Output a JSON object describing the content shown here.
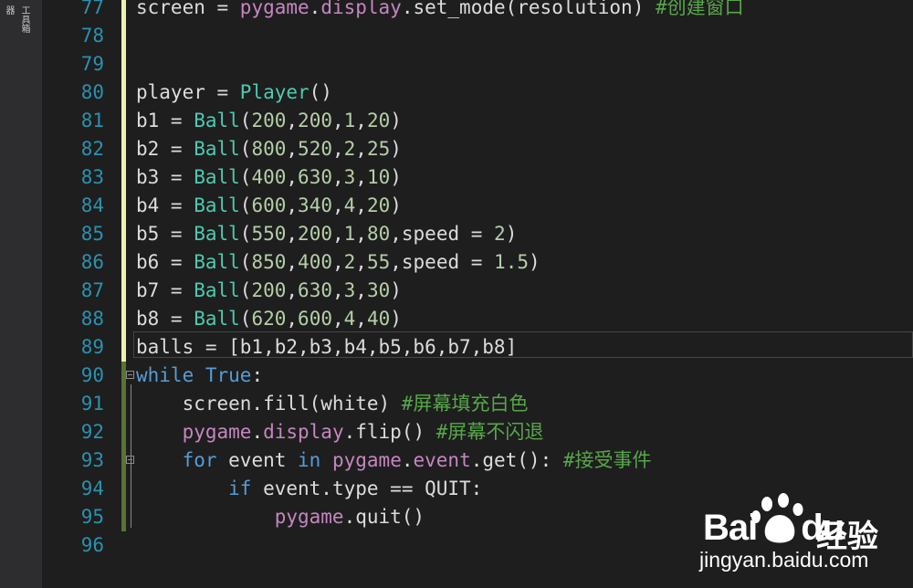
{
  "side_panel": {
    "tabs": [
      "器",
      "工具箱"
    ]
  },
  "watermark": {
    "brand": "Bai",
    "brand_suffix": "du",
    "cn": "经验",
    "url": "jingyan.baidu.com"
  },
  "editor": {
    "lines": [
      {
        "n": "77",
        "tokens": [
          [
            "plain",
            "screen = "
          ],
          [
            "mod",
            "pygame"
          ],
          [
            "plain",
            "."
          ],
          [
            "mod",
            "display"
          ],
          [
            "plain",
            "."
          ],
          [
            "plain",
            "set_mode(resolution) "
          ],
          [
            "cm",
            "#创建窗口"
          ]
        ]
      },
      {
        "n": "78",
        "tokens": []
      },
      {
        "n": "79",
        "tokens": []
      },
      {
        "n": "80",
        "tokens": [
          [
            "plain",
            "player = "
          ],
          [
            "cls",
            "Player"
          ],
          [
            "plain",
            "()"
          ]
        ]
      },
      {
        "n": "81",
        "tokens": [
          [
            "plain",
            "b1 = "
          ],
          [
            "cls",
            "Ball"
          ],
          [
            "plain",
            "("
          ],
          [
            "num",
            "200"
          ],
          [
            "plain",
            ","
          ],
          [
            "num",
            "200"
          ],
          [
            "plain",
            ","
          ],
          [
            "num",
            "1"
          ],
          [
            "plain",
            ","
          ],
          [
            "num",
            "20"
          ],
          [
            "plain",
            ")"
          ]
        ]
      },
      {
        "n": "82",
        "tokens": [
          [
            "plain",
            "b2 = "
          ],
          [
            "cls",
            "Ball"
          ],
          [
            "plain",
            "("
          ],
          [
            "num",
            "800"
          ],
          [
            "plain",
            ","
          ],
          [
            "num",
            "520"
          ],
          [
            "plain",
            ","
          ],
          [
            "num",
            "2"
          ],
          [
            "plain",
            ","
          ],
          [
            "num",
            "25"
          ],
          [
            "plain",
            ")"
          ]
        ]
      },
      {
        "n": "83",
        "tokens": [
          [
            "plain",
            "b3 = "
          ],
          [
            "cls",
            "Ball"
          ],
          [
            "plain",
            "("
          ],
          [
            "num",
            "400"
          ],
          [
            "plain",
            ","
          ],
          [
            "num",
            "630"
          ],
          [
            "plain",
            ","
          ],
          [
            "num",
            "3"
          ],
          [
            "plain",
            ","
          ],
          [
            "num",
            "10"
          ],
          [
            "plain",
            ")"
          ]
        ]
      },
      {
        "n": "84",
        "tokens": [
          [
            "plain",
            "b4 = "
          ],
          [
            "cls",
            "Ball"
          ],
          [
            "plain",
            "("
          ],
          [
            "num",
            "600"
          ],
          [
            "plain",
            ","
          ],
          [
            "num",
            "340"
          ],
          [
            "plain",
            ","
          ],
          [
            "num",
            "4"
          ],
          [
            "plain",
            ","
          ],
          [
            "num",
            "20"
          ],
          [
            "plain",
            ")"
          ]
        ]
      },
      {
        "n": "85",
        "tokens": [
          [
            "plain",
            "b5 = "
          ],
          [
            "cls",
            "Ball"
          ],
          [
            "plain",
            "("
          ],
          [
            "num",
            "550"
          ],
          [
            "plain",
            ","
          ],
          [
            "num",
            "200"
          ],
          [
            "plain",
            ","
          ],
          [
            "num",
            "1"
          ],
          [
            "plain",
            ","
          ],
          [
            "num",
            "80"
          ],
          [
            "plain",
            ",speed = "
          ],
          [
            "num",
            "2"
          ],
          [
            "plain",
            ")"
          ]
        ]
      },
      {
        "n": "86",
        "tokens": [
          [
            "plain",
            "b6 = "
          ],
          [
            "cls",
            "Ball"
          ],
          [
            "plain",
            "("
          ],
          [
            "num",
            "850"
          ],
          [
            "plain",
            ","
          ],
          [
            "num",
            "400"
          ],
          [
            "plain",
            ","
          ],
          [
            "num",
            "2"
          ],
          [
            "plain",
            ","
          ],
          [
            "num",
            "55"
          ],
          [
            "plain",
            ",speed = "
          ],
          [
            "num",
            "1.5"
          ],
          [
            "plain",
            ")"
          ]
        ]
      },
      {
        "n": "87",
        "tokens": [
          [
            "plain",
            "b7 = "
          ],
          [
            "cls",
            "Ball"
          ],
          [
            "plain",
            "("
          ],
          [
            "num",
            "200"
          ],
          [
            "plain",
            ","
          ],
          [
            "num",
            "630"
          ],
          [
            "plain",
            ","
          ],
          [
            "num",
            "3"
          ],
          [
            "plain",
            ","
          ],
          [
            "num",
            "30"
          ],
          [
            "plain",
            ")"
          ]
        ]
      },
      {
        "n": "88",
        "tokens": [
          [
            "plain",
            "b8 = "
          ],
          [
            "cls",
            "Ball"
          ],
          [
            "plain",
            "("
          ],
          [
            "num",
            "620"
          ],
          [
            "plain",
            ","
          ],
          [
            "num",
            "600"
          ],
          [
            "plain",
            ","
          ],
          [
            "num",
            "4"
          ],
          [
            "plain",
            ","
          ],
          [
            "num",
            "40"
          ],
          [
            "plain",
            ")"
          ]
        ]
      },
      {
        "n": "89",
        "tokens": [
          [
            "plain",
            "balls = [b1,b2,b3,b4,b5,b6,b7,b8]"
          ]
        ]
      },
      {
        "n": "90",
        "tokens": [
          [
            "kw",
            "while"
          ],
          [
            "plain",
            " "
          ],
          [
            "kw",
            "True"
          ],
          [
            "plain",
            ":"
          ]
        ]
      },
      {
        "n": "91",
        "tokens": [
          [
            "plain",
            "    screen.fill(white) "
          ],
          [
            "cm",
            "#屏幕填充白色"
          ]
        ]
      },
      {
        "n": "92",
        "tokens": [
          [
            "plain",
            "    "
          ],
          [
            "mod",
            "pygame"
          ],
          [
            "plain",
            "."
          ],
          [
            "mod",
            "display"
          ],
          [
            "plain",
            ".flip() "
          ],
          [
            "cm",
            "#屏幕不闪退"
          ]
        ]
      },
      {
        "n": "93",
        "tokens": [
          [
            "plain",
            "    "
          ],
          [
            "kw",
            "for"
          ],
          [
            "plain",
            " event "
          ],
          [
            "kw",
            "in"
          ],
          [
            "plain",
            " "
          ],
          [
            "mod",
            "pygame"
          ],
          [
            "plain",
            "."
          ],
          [
            "mod",
            "event"
          ],
          [
            "plain",
            ".get(): "
          ],
          [
            "cm",
            "#接受事件"
          ]
        ]
      },
      {
        "n": "94",
        "tokens": [
          [
            "plain",
            "        "
          ],
          [
            "kw",
            "if"
          ],
          [
            "plain",
            " event.type == QUIT:"
          ]
        ]
      },
      {
        "n": "95",
        "tokens": [
          [
            "plain",
            "            "
          ],
          [
            "mod",
            "pygame"
          ],
          [
            "plain",
            ".quit()"
          ]
        ]
      },
      {
        "n": "96",
        "tokens": []
      }
    ],
    "line_marks": {
      "77": "yellow",
      "78": "yellow",
      "79": "yellow",
      "80": "yellow",
      "81": "yellow",
      "82": "yellow",
      "83": "yellow",
      "84": "yellow",
      "85": "yellow",
      "86": "yellow",
      "87": "yellow",
      "88": "yellow",
      "89": "yellow",
      "90": "green",
      "91": "green",
      "92": "green",
      "93": "green",
      "94": "green",
      "95": "green"
    },
    "fold_lines": [
      "90",
      "93"
    ],
    "current_line": "89"
  }
}
